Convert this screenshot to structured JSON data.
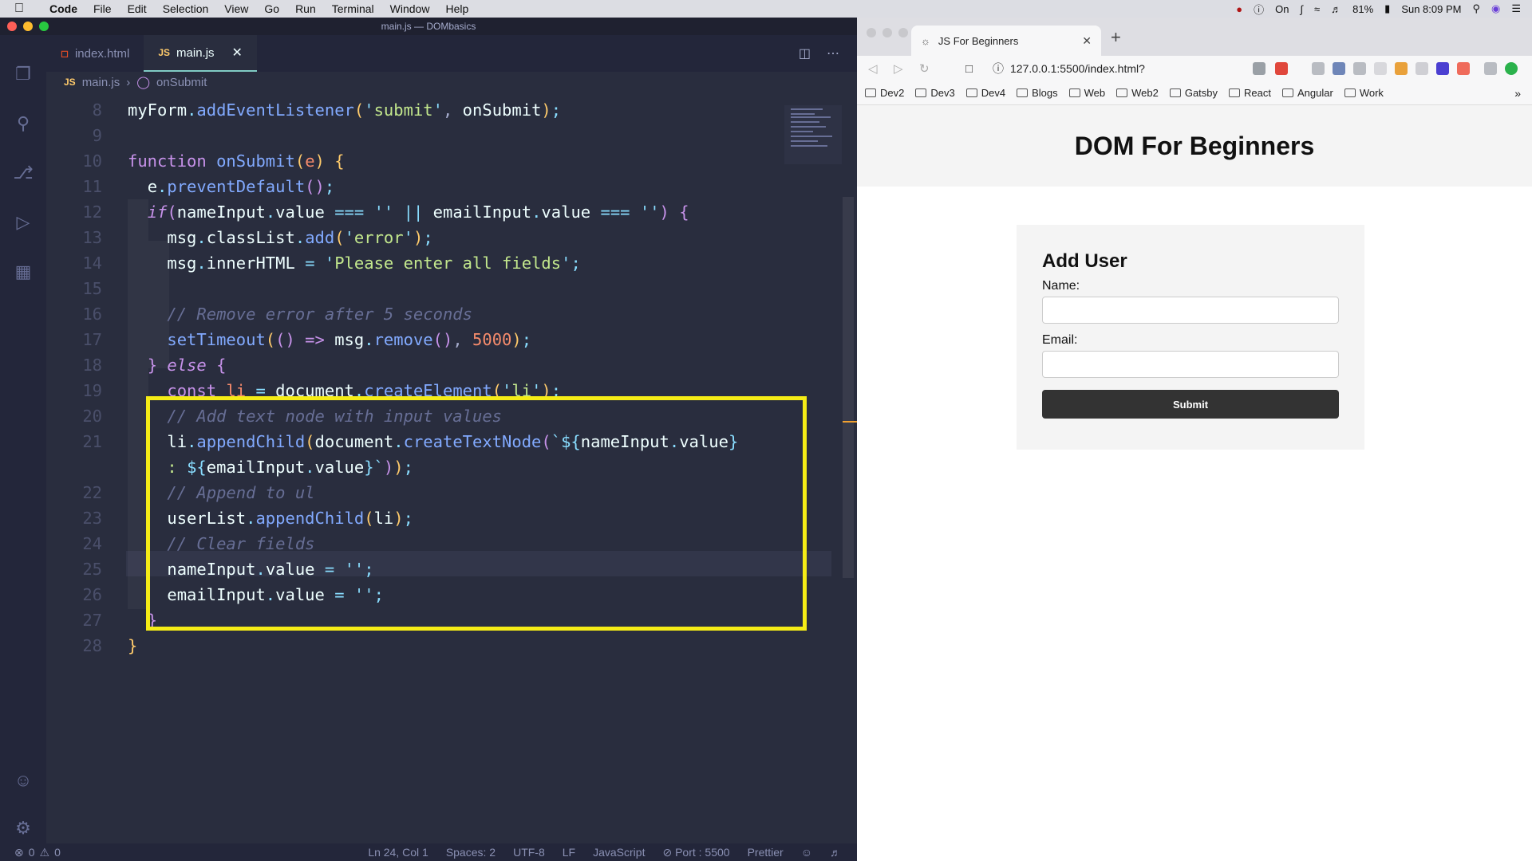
{
  "menubar": {
    "app": "Code",
    "items": [
      "File",
      "Edit",
      "Selection",
      "View",
      "Go",
      "Run",
      "Terminal",
      "Window",
      "Help"
    ],
    "vpn": "On",
    "battery": "81%",
    "clock": "Sun 8:09 PM"
  },
  "vscode": {
    "window_title": "main.js — DOMbasics",
    "tabs": [
      {
        "label": "index.html",
        "icon": "html-file-icon"
      },
      {
        "label": "main.js",
        "icon": "js-file-icon"
      }
    ],
    "breadcrumb": {
      "file": "main.js",
      "symbol": "onSubmit"
    },
    "status": {
      "errors": "0",
      "warnings": "0",
      "position": "Ln 24, Col 1",
      "spaces": "Spaces: 2",
      "encoding": "UTF-8",
      "eol": "LF",
      "language": "JavaScript",
      "port": "Port : 5500",
      "formatter": "Prettier"
    },
    "line_numbers": [
      "8",
      "9",
      "10",
      "11",
      "12",
      "13",
      "14",
      "15",
      "16",
      "17",
      "18",
      "19",
      "20",
      "21",
      "22",
      "23",
      "24",
      "25",
      "26",
      "27",
      "28"
    ]
  },
  "browser": {
    "tab_title": "JS For Beginners",
    "url": "127.0.0.1:5500/index.html?",
    "bookmarks": [
      "Dev2",
      "Dev3",
      "Dev4",
      "Blogs",
      "Web",
      "Web2",
      "Gatsby",
      "React",
      "Angular",
      "Work"
    ],
    "page": {
      "heading": "DOM For Beginners",
      "form_title": "Add User",
      "name_label": "Name:",
      "email_label": "Email:",
      "submit_label": "Submit"
    }
  }
}
